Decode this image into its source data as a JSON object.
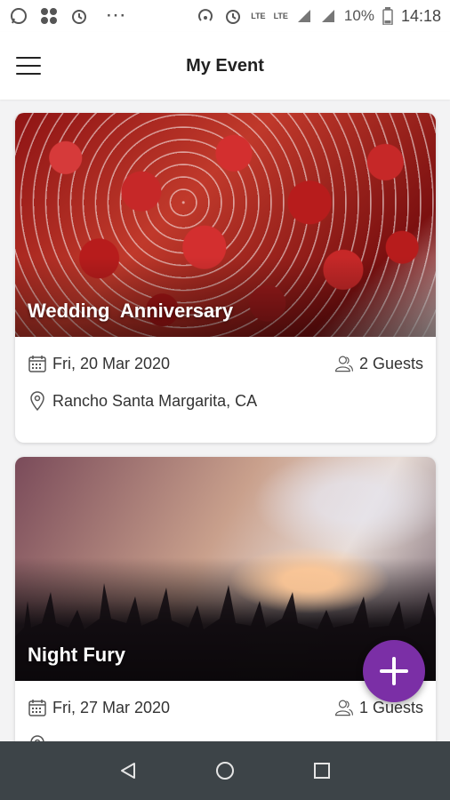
{
  "status_bar": {
    "time": "14:18",
    "battery": "10%",
    "network_1": "LTE",
    "network_2": "LTE",
    "overflow": "···"
  },
  "app_bar": {
    "title": "My Event"
  },
  "events": [
    {
      "title": "Wedding  Anniversary",
      "date": "Fri, 20 Mar 2020",
      "guests": "2 Guests",
      "location": "Rancho Santa Margarita, CA"
    },
    {
      "title": "Night Fury",
      "date": "Fri, 27 Mar 2020",
      "guests": "1 Guests"
    }
  ],
  "colors": {
    "accent": "#7b2fa6",
    "nav_bar": "#3d4448"
  },
  "icons": {
    "menu": "hamburger-icon",
    "date": "calendar-icon",
    "guests": "people-icon",
    "location": "location-pin-icon",
    "fab": "plus-icon"
  }
}
